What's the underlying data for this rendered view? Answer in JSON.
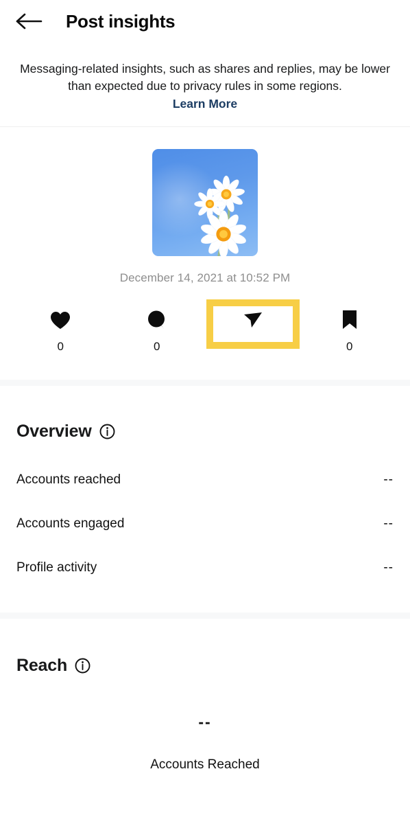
{
  "header": {
    "title": "Post insights",
    "back_icon": "back-arrow-icon"
  },
  "notice": {
    "text": "Messaging-related insights, such as shares and replies, may be lower than expected due to privacy rules in some regions.",
    "link_label": "Learn More"
  },
  "post": {
    "thumbnail_alt": "daisies-against-blue-sky",
    "date": "December 14, 2021 at 10:52 PM"
  },
  "actions": [
    {
      "icon": "heart-icon",
      "name": "likes",
      "count": "0"
    },
    {
      "icon": "comment-icon",
      "name": "comments",
      "count": "0"
    },
    {
      "icon": "share-icon",
      "name": "shares",
      "count": ""
    },
    {
      "icon": "bookmark-icon",
      "name": "saves",
      "count": "0"
    }
  ],
  "overview": {
    "title": "Overview",
    "info_icon": "info-icon",
    "rows": [
      {
        "label": "Accounts reached",
        "value": "--"
      },
      {
        "label": "Accounts engaged",
        "value": "--"
      },
      {
        "label": "Profile activity",
        "value": "--"
      }
    ]
  },
  "reach": {
    "title": "Reach",
    "info_icon": "info-icon",
    "value": "--",
    "label": "Accounts Reached"
  },
  "colors": {
    "highlight": "#f7ce46",
    "link": "#1c3d63",
    "muted_text": "#8e8e8e",
    "band": "#f7f8f9"
  }
}
